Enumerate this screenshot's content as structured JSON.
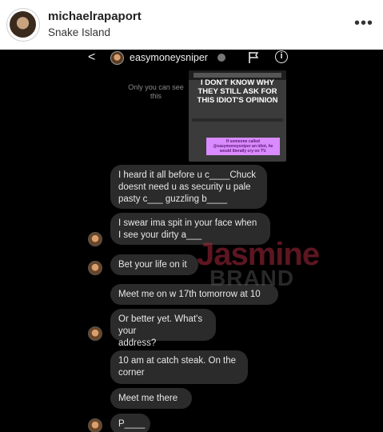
{
  "post": {
    "username": "michaelrapaport",
    "location": "Snake Island",
    "more_icon": "more-horizontal-icon",
    "more_label": "•••"
  },
  "dm": {
    "back_label": "<",
    "username": "easymoneysniper",
    "only_you_text": "Only you can see this",
    "story_headline": "I DON'T KNOW WHY THEY STILL ASK FOR THIS IDIOT'S OPINION",
    "story_caption": "If someone called @easymoneysniper an idiot, he would literally cry on TV.",
    "caption_color": "#d98bff"
  },
  "messages": [
    {
      "text": "I heard it all before u c____Chuck\ndoesnt need u as security u pale\npasty c___ guzzling b____"
    },
    {
      "text": "I swear ima spit in your face when\nI see your dirty a___"
    },
    {
      "text": "Bet your life on it"
    },
    {
      "text": "Meet me on w 17th tomorrow at 10"
    },
    {
      "text": "Or better yet. What's your\naddress?"
    },
    {
      "text": "10 am at catch steak. On the\ncorner"
    },
    {
      "text": "Meet me there"
    },
    {
      "text": "P____"
    }
  ],
  "watermark": {
    "brand": "Jasmine",
    "sub": "BRAND"
  },
  "colors": {
    "bubble": "#2b2b2b",
    "screen_bg": "#000000",
    "watermark": "#aa283c"
  }
}
